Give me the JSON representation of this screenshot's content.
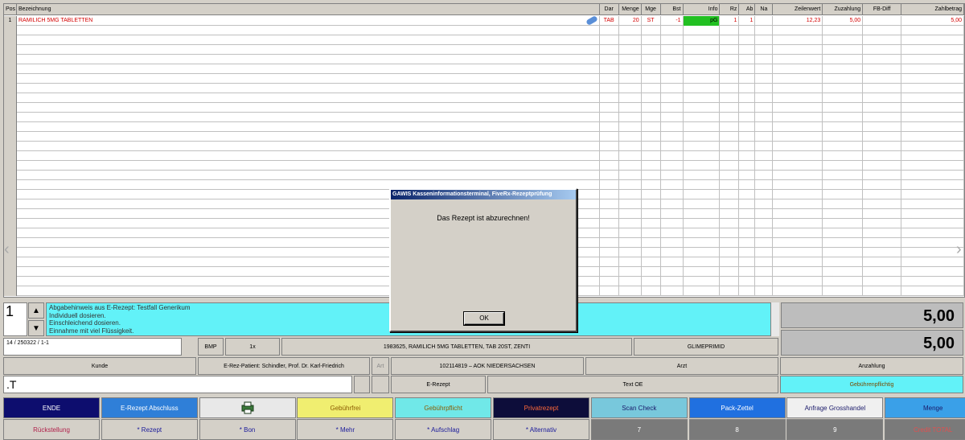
{
  "grid": {
    "columns": [
      {
        "key": "pos",
        "label": "Pos",
        "w": 16,
        "align": "c"
      },
      {
        "key": "bez",
        "label": "Bezeichnung",
        "w": 726,
        "align": "l"
      },
      {
        "key": "dar",
        "label": "Dar",
        "w": 24,
        "align": "c"
      },
      {
        "key": "menge",
        "label": "Menge",
        "w": 28,
        "align": "r"
      },
      {
        "key": "mge",
        "label": "Mge",
        "w": 24,
        "align": "c"
      },
      {
        "key": "bst",
        "label": "Bst",
        "w": 28,
        "align": "r"
      },
      {
        "key": "info",
        "label": "Info",
        "w": 46,
        "align": "r"
      },
      {
        "key": "rz",
        "label": "Rz",
        "w": 24,
        "align": "r"
      },
      {
        "key": "ab",
        "label": "Ab",
        "w": 20,
        "align": "r"
      },
      {
        "key": "na",
        "label": "Na",
        "w": 22,
        "align": "c"
      },
      {
        "key": "zeilenwert",
        "label": "Zeilenwert",
        "w": 62,
        "align": "r"
      },
      {
        "key": "zuzahlung",
        "label": "Zuzahlung",
        "w": 50,
        "align": "r"
      },
      {
        "key": "fbdiff",
        "label": "FB-Diff",
        "w": 48,
        "align": "c"
      },
      {
        "key": "zahlbetrag",
        "label": "Zahlbetrag",
        "w": 78,
        "align": "r"
      }
    ],
    "rows": [
      {
        "pos": "1",
        "bez": "RAMILICH 5MG TABLETTEN",
        "dar": "TAB",
        "menge": "20",
        "mge": "ST",
        "bst": "-1",
        "info": "pG",
        "rz": "1",
        "ab": "1",
        "na": "",
        "zeilenwert": "12,23",
        "zuzahlung": "5,00",
        "fbdiff": "",
        "zahlbetrag": "5,00"
      }
    ],
    "empty_rows": 28
  },
  "quantity": "1",
  "hint_lines": [
    "Abgabehinweis aus E-Rezept: Testfall Generikum",
    "Individuell dosieren.",
    "Einschleichend dosieren.",
    "Einnahme mit viel Flüssigkeit."
  ],
  "totals": {
    "first": "5,00",
    "second": "5,00"
  },
  "info_bar": {
    "receipt_no": "14 / 250322 / 1-1",
    "bmp": "BMP",
    "count": "1x",
    "article": "1983625, RAMILICH 5MG TABLETTEN, TAB     20ST, ZENTI",
    "substance": "GLIMEPRIMID"
  },
  "customer_bar": {
    "kunde": "Kunde",
    "patient": "E-Rez-Patient: Schindler, Prof. Dr. Karl-Friedrich",
    "art": "Art",
    "kasse": "102114819 – AOK NIEDERSACHSEN",
    "arzt": "Arzt",
    "anzahlung": "Anzahlung"
  },
  "input_bar": {
    "value": ".T",
    "erezept": "E-Rezept",
    "text_oe": "Text OE",
    "gebuehren": "Gebührenpflichtig"
  },
  "buttons_top": [
    {
      "label": "ENDE",
      "bg": "#0d0d6e",
      "fg": "#ffffff"
    },
    {
      "label": "E-Rezept Abschluss",
      "bg": "#2f7fd8",
      "fg": "#ffffff"
    },
    {
      "label": "",
      "bg": "#e8e8e8",
      "fg": "#000000",
      "icon": "printer-icon"
    },
    {
      "label": "Gebührfrei",
      "bg": "#f0ee70",
      "fg": "#8a5a00"
    },
    {
      "label": "Gebührpflicht",
      "bg": "#70e8e8",
      "fg": "#8a5a00"
    },
    {
      "label": "Privatrezept",
      "bg": "#0d0d3a",
      "fg": "#ff6a3a"
    },
    {
      "label": "Scan Check",
      "bg": "#78c8dc",
      "fg": "#1a1a6a"
    },
    {
      "label": "Pack-Zettel",
      "bg": "#2070e0",
      "fg": "#ffffff"
    },
    {
      "label": "Anfrage Grosshandel",
      "bg": "#f0f0f0",
      "fg": "#1a1a6a"
    },
    {
      "label": "Menge",
      "bg": "#3aa0e8",
      "fg": "#1a1a6a"
    }
  ],
  "buttons_bottom": [
    {
      "label": "Rückstellung",
      "bg": "#d4d0c8",
      "fg": "#b0204a"
    },
    {
      "label": "* Rezept",
      "bg": "#d4d0c8",
      "fg": "#1a1a9a"
    },
    {
      "label": "* Bon",
      "bg": "#d4d0c8",
      "fg": "#1a1a9a"
    },
    {
      "label": "* Mehr",
      "bg": "#d4d0c8",
      "fg": "#1a1a9a"
    },
    {
      "label": "* Aufschlag",
      "bg": "#d4d0c8",
      "fg": "#1a1a9a"
    },
    {
      "label": "* Alternativ",
      "bg": "#d4d0c8",
      "fg": "#1a1a9a"
    },
    {
      "label": "7",
      "bg": "#7a7a7a",
      "fg": "#ffffff"
    },
    {
      "label": "8",
      "bg": "#7a7a7a",
      "fg": "#ffffff"
    },
    {
      "label": "9",
      "bg": "#7a7a7a",
      "fg": "#ffffff"
    },
    {
      "label": "Credit TOTAL",
      "bg": "#7a7a7a",
      "fg": "#e05050"
    }
  ],
  "dialog": {
    "title": "GAWIS Kasseninformationsterminal, FiveRx-Rezeptprüfung",
    "message": "Das Rezept ist abzurechnen!",
    "ok": "OK"
  }
}
